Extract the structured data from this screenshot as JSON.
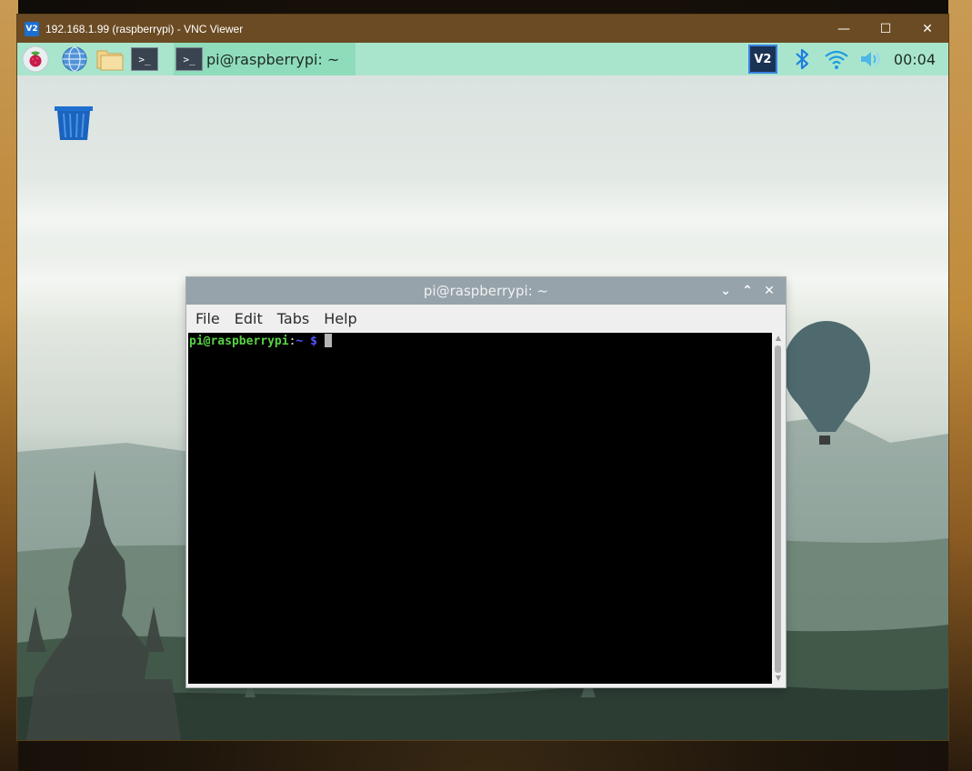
{
  "vnc": {
    "logo_text": "V2",
    "title": "192.168.1.99 (raspberrypi) - VNC Viewer",
    "minimize": "—",
    "maximize": "☐",
    "close": "✕"
  },
  "panel": {
    "launchers": [
      "raspberry-menu-icon",
      "browser-globe-icon",
      "file-manager-icon",
      "terminal-icon"
    ],
    "terminal_glyph": ">_",
    "task_label": "pi@raspberrypi: ~",
    "tray": [
      "vnc-server-icon",
      "bluetooth-icon",
      "wifi-icon",
      "volume-icon"
    ],
    "vnc_tray_text": "V2",
    "clock": "00:04"
  },
  "desktop": {
    "icons": [
      "trash-icon"
    ]
  },
  "terminal": {
    "title": "pi@raspberrypi: ~",
    "controls": [
      "⌄",
      "⌃",
      "✕"
    ],
    "menu": [
      "File",
      "Edit",
      "Tabs",
      "Help"
    ],
    "prompt_user": "pi@raspberrypi",
    "prompt_sep": ":",
    "prompt_path": "~",
    "prompt_symbol": "$"
  },
  "colors": {
    "panel_bg": "#a9e5cd",
    "vnc_titlebar": "#6b4b23",
    "terminal_bg": "#000000",
    "prompt_user": "#58d344",
    "prompt_path": "#5555ff"
  }
}
